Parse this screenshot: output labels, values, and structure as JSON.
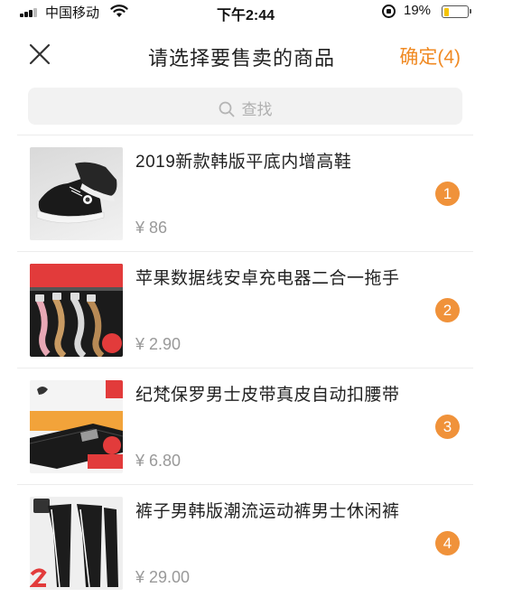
{
  "status_bar": {
    "carrier": "中国移动",
    "time": "下午2:44",
    "battery_percent_label": "19%",
    "battery_level": 0.19,
    "icons": [
      "signal-icon",
      "wifi-icon",
      "orientation-lock-icon",
      "battery-icon"
    ]
  },
  "nav": {
    "title": "请选择要售卖的商品",
    "close_icon": "close-icon",
    "confirm_label": "确定(4)"
  },
  "search": {
    "placeholder": "查找",
    "icon": "search-icon"
  },
  "colors": {
    "accent": "#f08a23",
    "badge": "#f0923a",
    "price": "#999999",
    "search_bg": "#f2f2f2"
  },
  "products": [
    {
      "title": "2019新款韩版平底内增高鞋",
      "price": "¥ 86",
      "order": "1"
    },
    {
      "title": "苹果数据线安卓充电器二合一拖手",
      "price": "¥ 2.90",
      "order": "2"
    },
    {
      "title": "纪梵保罗男士皮带真皮自动扣腰带",
      "price": "¥ 6.80",
      "order": "3"
    },
    {
      "title": "裤子男韩版潮流运动裤男士休闲裤",
      "price": "¥ 29.00",
      "order": "4"
    }
  ]
}
